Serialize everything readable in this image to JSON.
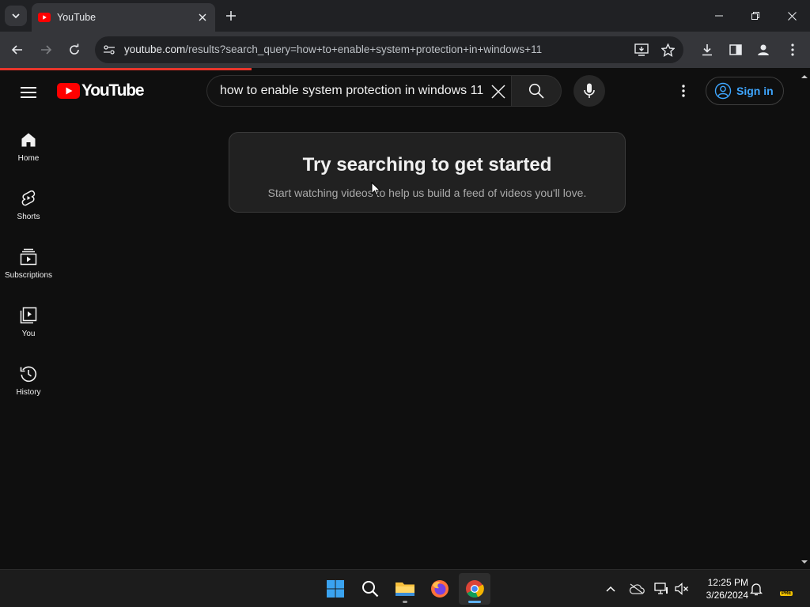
{
  "browser": {
    "tab_title": "YouTube",
    "url_host": "youtube.com",
    "url_path": "/results?search_query=how+to+enable+system+protection+in+windows+11"
  },
  "youtube": {
    "logo_text": "YouTube",
    "search_value": "how to enable system protection in windows 11",
    "sign_in_label": "Sign in",
    "sidebar": {
      "items": [
        {
          "label": "Home",
          "icon": "home-icon"
        },
        {
          "label": "Shorts",
          "icon": "shorts-icon"
        },
        {
          "label": "Subscriptions",
          "icon": "subscriptions-icon"
        },
        {
          "label": "You",
          "icon": "you-icon"
        },
        {
          "label": "History",
          "icon": "history-icon"
        }
      ]
    },
    "empty_state": {
      "title": "Try searching to get started",
      "subtitle": "Start watching videos to help us build a feed of videos you'll love."
    }
  },
  "taskbar": {
    "time": "12:25 PM",
    "date": "3/26/2024",
    "badge": "PRE"
  },
  "colors": {
    "accent_blue": "#3ea6ff",
    "youtube_red": "#ff0000",
    "background": "#0f0f0f"
  }
}
